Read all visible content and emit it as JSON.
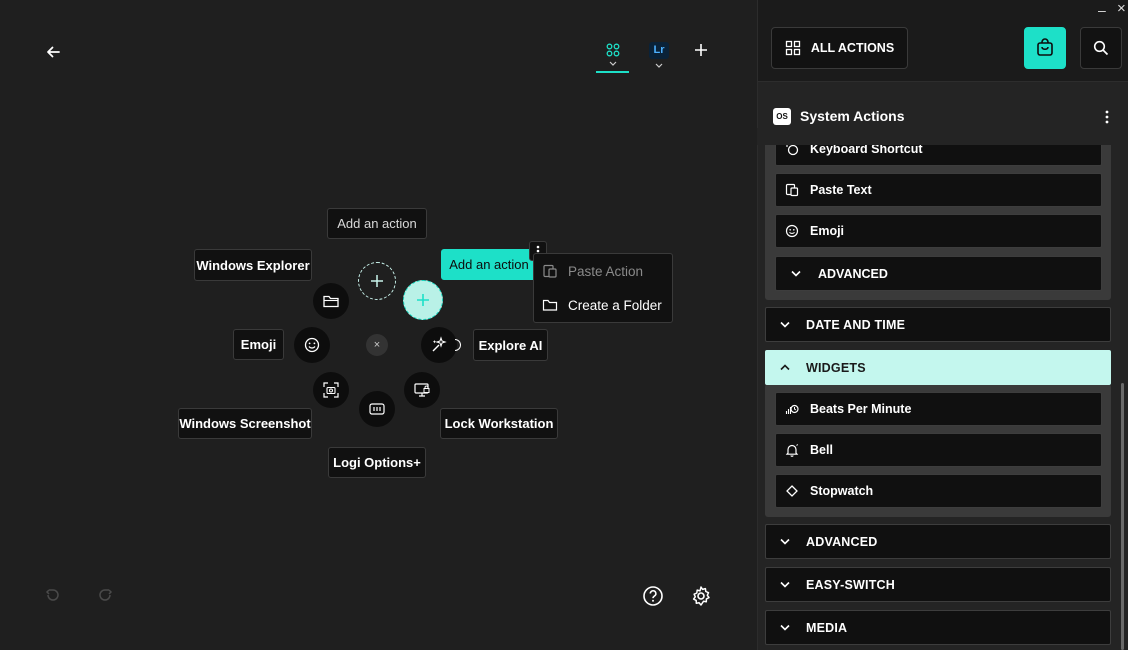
{
  "toolbar": {
    "back_icon": "arrow-left-icon",
    "apps": [
      {
        "name": "grid-app-icon",
        "label": ""
      },
      {
        "name": "lightroom-app-icon",
        "label": "Lr"
      }
    ],
    "add_icon": "plus-icon"
  },
  "ring": {
    "labels": {
      "add_action_top": "Add an action",
      "add_action_active": "Add an action",
      "windows_explorer": "Windows Explorer",
      "emoji": "Emoji",
      "explore_ai": "Explore AI",
      "windows_screenshot": "Windows Screenshot",
      "lock_workstation": "Lock Workstation",
      "logi_options": "Logi Options+"
    },
    "center_close": "×"
  },
  "context_menu": {
    "items": [
      {
        "label": "Paste Action",
        "disabled": true
      },
      {
        "label": "Create a Folder",
        "disabled": false
      }
    ]
  },
  "bottom": {
    "undo_icon": "undo-icon",
    "redo_icon": "redo-icon",
    "help_icon": "help-icon",
    "settings_icon": "gear-icon"
  },
  "window": {
    "minimize": "–",
    "close": "×"
  },
  "sidebar": {
    "all_actions_label": "ALL ACTIONS",
    "marketplace_icon": "store-bag-icon",
    "search_icon": "search-icon",
    "section_badge": "OS",
    "section_title": "System Actions",
    "system_items": [
      "Keyboard Shortcut",
      "Paste Text",
      "Emoji"
    ],
    "advanced_sub": "ADVANCED",
    "categories": {
      "date_time": "DATE AND TIME",
      "widgets": "WIDGETS",
      "advanced": "ADVANCED",
      "easy_switch": "EASY-SWITCH",
      "media": "MEDIA"
    },
    "widget_items": [
      "Beats Per Minute",
      "Bell",
      "Stopwatch"
    ]
  },
  "colors": {
    "accent": "#1de0c8",
    "accent_light": "#c4f7ee",
    "background": "#1f1f1f",
    "sidebar": "#242424"
  }
}
